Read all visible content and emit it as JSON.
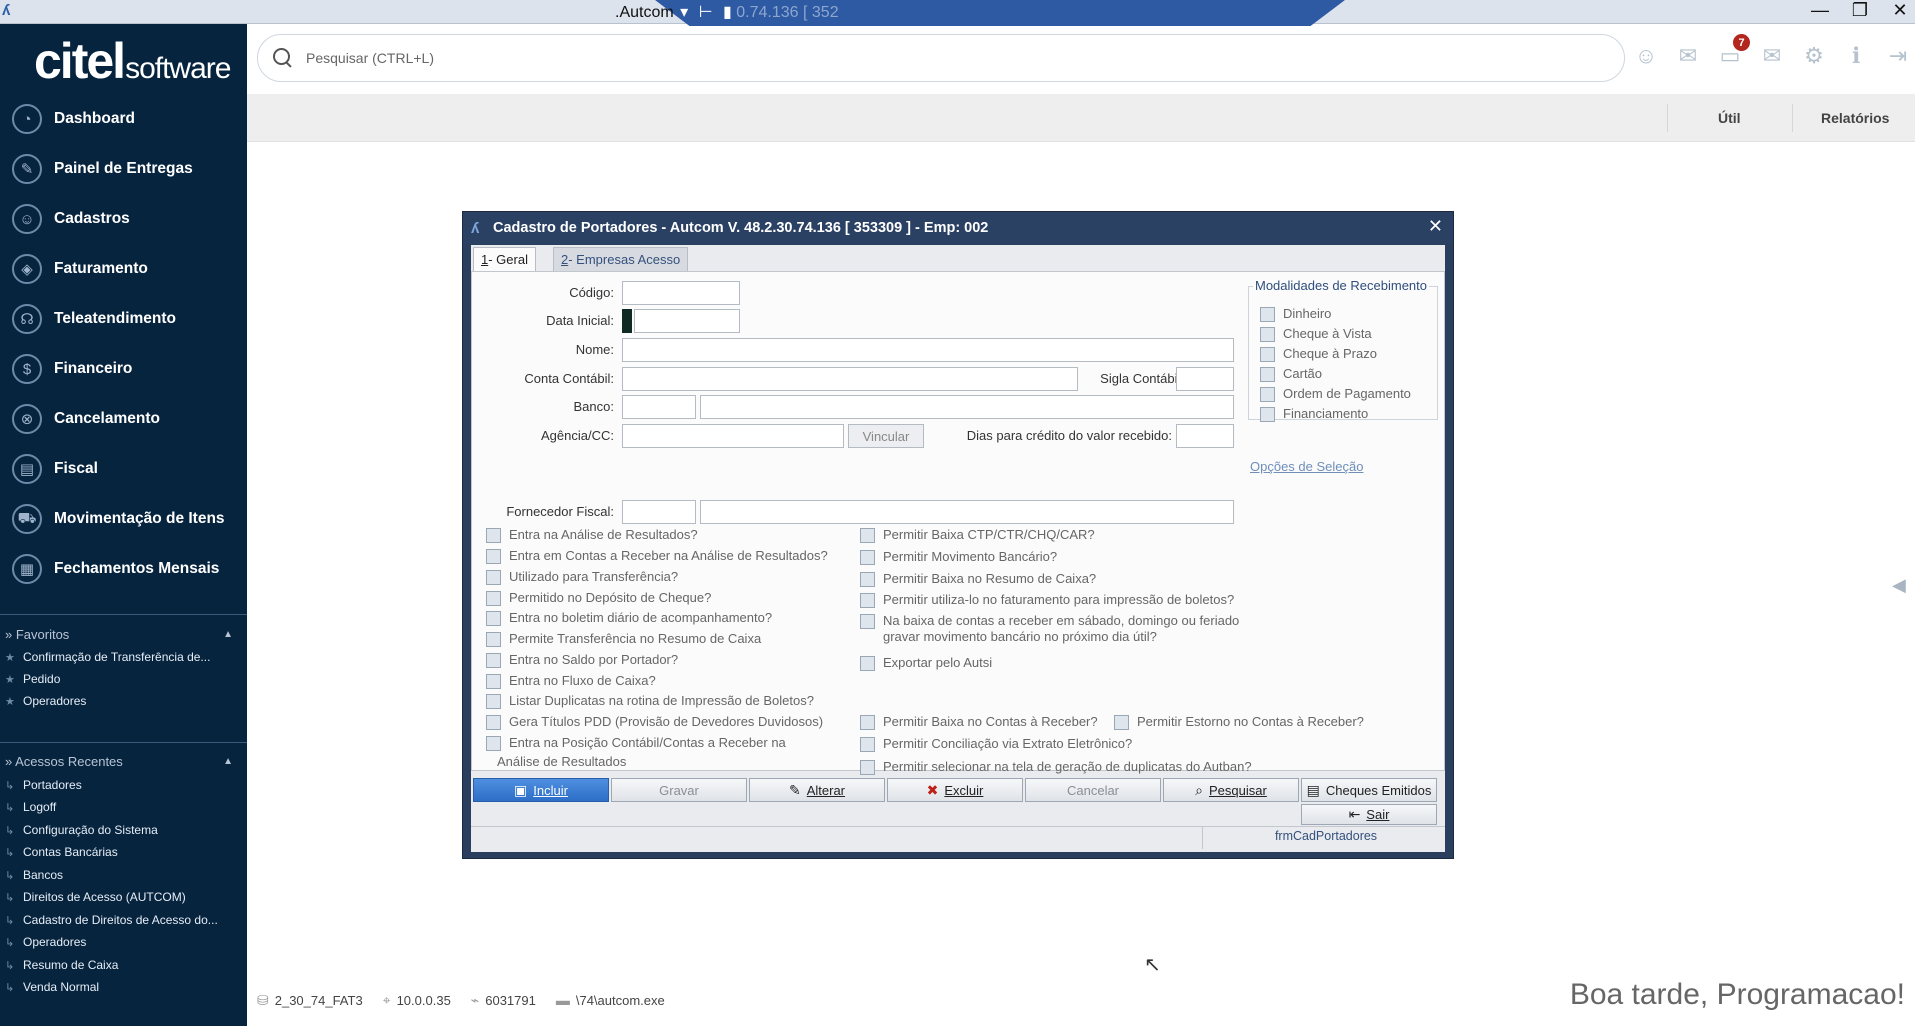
{
  "remote_bar": {
    "title_visible": ".Autcom",
    "title_faded": "0.74.136 [ 352",
    "controls": [
      "—",
      "❐",
      "✕"
    ]
  },
  "brand": {
    "name": "citel",
    "suffix": "software"
  },
  "sidebar": {
    "items": [
      {
        "label": "Dashboard",
        "icon": "dashboard-icon"
      },
      {
        "label": "Painel de Entregas",
        "icon": "delivery-icon"
      },
      {
        "label": "Cadastros",
        "icon": "users-icon"
      },
      {
        "label": "Faturamento",
        "icon": "tag-icon"
      },
      {
        "label": "Teleatendimento",
        "icon": "headset-icon"
      },
      {
        "label": "Financeiro",
        "icon": "dollar-icon"
      },
      {
        "label": "Cancelamento",
        "icon": "cancel-icon"
      },
      {
        "label": "Fiscal",
        "icon": "document-icon"
      },
      {
        "label": "Movimentação de Itens",
        "icon": "truck-icon"
      },
      {
        "label": "Fechamentos Mensais",
        "icon": "calendar-icon"
      }
    ],
    "favorites": {
      "title": "» Favoritos",
      "items": [
        "Confirmação de Transferência de...",
        "Pedido",
        "Operadores"
      ]
    },
    "recent": {
      "title": "» Acessos Recentes",
      "items": [
        "Portadores",
        "Logoff",
        "Configuração do Sistema",
        "Contas Bancárias",
        "Bancos",
        "Direitos de Acesso (AUTCOM)",
        "Cadastro de Direitos de Acesso do...",
        "Operadores",
        "Resumo de Caixa",
        "Venda Normal"
      ]
    }
  },
  "search": {
    "placeholder": "Pesquisar (CTRL+L)"
  },
  "header_icons": {
    "notification_count": "7",
    "icons": [
      "support-agent-icon",
      "mail-open-icon",
      "chat-icon",
      "mail-icon",
      "gear-icon",
      "info-icon",
      "logout-icon"
    ]
  },
  "toolbar": {
    "util_label": "Útil",
    "reports_label": "Relatórios"
  },
  "dialog": {
    "title": "Cadastro de Portadores  -  Autcom V. 48.2.30.74.136 [ 353309 ] - Emp: 002",
    "tabs": [
      {
        "key": "1",
        "label": " - Geral"
      },
      {
        "key": "2",
        "label": " - Empresas Acesso"
      }
    ],
    "fields": {
      "codigo": "Código:",
      "data_inicial": "Data Inicial:",
      "nome": "Nome:",
      "conta_contabil": "Conta Contábil:",
      "sigla_contabil": "Sigla Contábil:",
      "banco": "Banco:",
      "agencia_cc": "Agência/CC:",
      "vincular": "Vincular",
      "dias_credito": "Dias para crédito do valor recebido:",
      "fornecedor_fiscal": "Fornecedor Fiscal:"
    },
    "modalidades": {
      "title": "Modalidades de Recebimento",
      "items": [
        "Dinheiro",
        "Cheque à Vista",
        "Cheque à Prazo",
        "Cartão",
        "Ordem de Pagamento",
        "Financiamento"
      ]
    },
    "opcoes_link": "Opções de Seleção",
    "left_checks": [
      "Entra na Análise de Resultados?",
      "Entra em Contas a Receber na Análise de Resultados?",
      "Utilizado para Transferência?",
      "Permitido no Depósito de Cheque?",
      "Entra no boletim diário de acompanhamento?",
      "Permite Transferência no Resumo de Caixa",
      "Entra no Saldo por Portador?",
      "Entra no Fluxo de Caixa?",
      "Listar Duplicatas na rotina de Impressão de Boletos?",
      "Gera Títulos PDD (Provisão de Devedores Duvidosos)",
      "Entra na Posição Contábil/Contas a Receber na",
      "Análise de Resultados"
    ],
    "right_checks": [
      "Permitir Baixa CTP/CTR/CHQ/CAR?",
      "Permitir Movimento Bancário?",
      "Permitir Baixa no Resumo de Caixa?",
      "Permitir utiliza-lo no faturamento para impressão de boletos?",
      "Na baixa de contas a receber em sábado, domingo ou feriado",
      "gravar movimento bancário no próximo dia útil?",
      "Exportar pelo Autsi",
      "Permitir Baixa no Contas à Receber?",
      "Permitir Estorno no Contas à Receber?",
      "Permitir Conciliação via Extrato Eletrônico?",
      "Permitir selecionar na tela de geração de duplicatas do Autban?"
    ],
    "buttons": {
      "incluir": "Incluir",
      "gravar": "Gravar",
      "alterar": "Alterar",
      "excluir": "Excluir",
      "cancelar": "Cancelar",
      "pesquisar": "Pesquisar",
      "cheques": "Cheques Emitidos",
      "sair": "Sair"
    },
    "form_name": "frmCadPortadores"
  },
  "footer": {
    "version": "2_30_74_FAT3",
    "ip": "10.0.0.35",
    "id": "6031791",
    "path": "\\74\\autcom.exe"
  },
  "greeting": "Boa tarde, Programacao!"
}
